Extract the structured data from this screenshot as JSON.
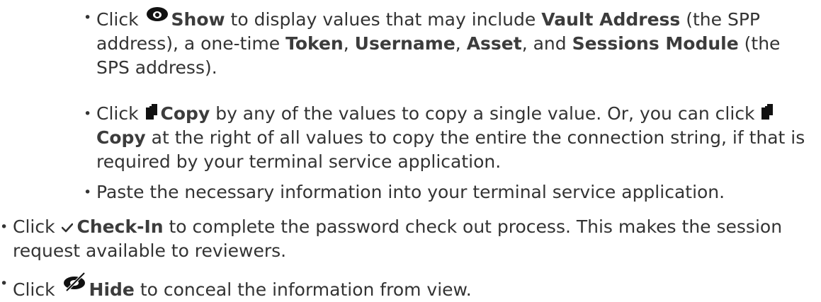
{
  "list": {
    "show": {
      "p1": "Click ",
      "b1": "Show",
      "p2": " to display values that may include ",
      "b2": "Vault Address",
      "p3": " (the SPP address), a one-time ",
      "b3": "Token",
      "p4": ", ",
      "b4": "Username",
      "p5": ", ",
      "b5": "Asset",
      "p6": ", and ",
      "b6": "Sessions Module",
      "p7": " (the SPS address).",
      "icon": "eye-icon"
    },
    "copy": {
      "p1": "Click ",
      "b1": "Copy",
      "p2": " by any of the values to copy a single value. Or, you can click ",
      "b2": "Copy",
      "p3": " at the right of all values to copy the entire the connection string, if that is required by your terminal service application.",
      "icon": "copy-icon"
    },
    "paste": {
      "text": "Paste the necessary information into your terminal service application."
    },
    "checkin": {
      "p1": "Click ",
      "b1": "Check-In",
      "p2": " to complete the password check out process. This makes the session request available to reviewers.",
      "icon": "checkmark-icon"
    },
    "hide": {
      "p1": "Click ",
      "b1": "Hide",
      "p2": " to conceal the information from view.",
      "icon": "eye-slash-icon"
    }
  }
}
